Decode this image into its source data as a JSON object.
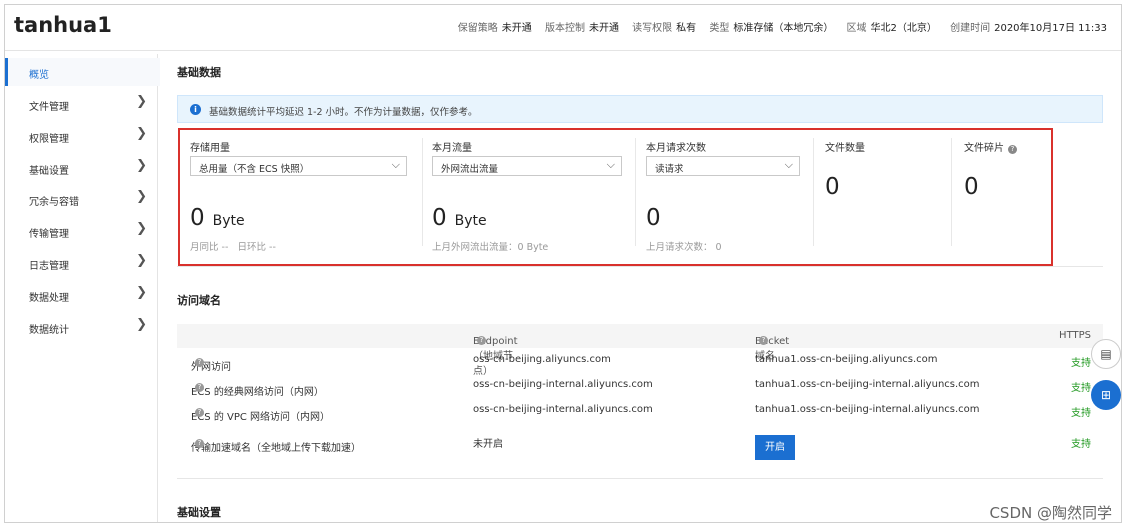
{
  "bucket_name": "tanhua1",
  "meta": [
    {
      "key": "保留策略",
      "value": "未开通"
    },
    {
      "key": "版本控制",
      "value": "未开通"
    },
    {
      "key": "读写权限",
      "value": "私有"
    },
    {
      "key": "类型",
      "value": "标准存储（本地冗余）"
    },
    {
      "key": "区域",
      "value": "华北2（北京）"
    },
    {
      "key": "创建时间",
      "value": "2020年10月17日 11:33"
    }
  ],
  "sidebar": [
    {
      "label": "概览"
    },
    {
      "label": "文件管理"
    },
    {
      "label": "权限管理"
    },
    {
      "label": "基础设置"
    },
    {
      "label": "冗余与容错"
    },
    {
      "label": "传输管理"
    },
    {
      "label": "日志管理"
    },
    {
      "label": "数据处理"
    },
    {
      "label": "数据统计"
    }
  ],
  "basic_data": {
    "title": "基础数据",
    "notice": "基础数据统计平均延迟 1-2 小时。不作为计量数据，仅作参考。",
    "storage": {
      "title": "存储用量",
      "select": "总用量（不含 ECS 快照）",
      "value": "0",
      "unit": "Byte",
      "sub_month": "月同比",
      "sub_month_val": "--",
      "sub_day": "日环比",
      "sub_day_val": "--"
    },
    "traffic": {
      "title": "本月流量",
      "select": "外网流出流量",
      "value": "0",
      "unit": "Byte",
      "sub": "上月外网流出流量：0 Byte"
    },
    "requests": {
      "title": "本月请求次数",
      "select": "读请求",
      "value": "0",
      "sub": "上月请求次数： 0"
    },
    "files": {
      "title": "文件数量",
      "value": "0"
    },
    "fragments": {
      "title": "文件碎片",
      "value": "0"
    }
  },
  "access_domain": {
    "title": "访问域名",
    "headers": {
      "endpoint": "Endpoint（地域节点）",
      "bucket": "Bucket 域名",
      "https": "HTTPS"
    },
    "rows": [
      {
        "name": "外网访问",
        "endpoint": "oss-cn-beijing.aliyuncs.com",
        "bucket": "tanhua1.oss-cn-beijing.aliyuncs.com",
        "https": "支持"
      },
      {
        "name": "ECS 的经典网络访问（内网）",
        "endpoint": "oss-cn-beijing-internal.aliyuncs.com",
        "bucket": "tanhua1.oss-cn-beijing-internal.aliyuncs.com",
        "https": "支持"
      },
      {
        "name": "ECS 的 VPC 网络访问（内网）",
        "endpoint": "oss-cn-beijing-internal.aliyuncs.com",
        "bucket": "tanhua1.oss-cn-beijing-internal.aliyuncs.com",
        "https": "支持"
      },
      {
        "name": "传输加速域名（全地域上传下载加速）",
        "endpoint": "未开启",
        "button": "开启",
        "https": "支持"
      }
    ]
  },
  "basic_settings_title": "基础设置",
  "watermark": "CSDN @陶然同学",
  "colors": {
    "accent": "#1b6fd1",
    "highlight_border": "#d9312c",
    "support": "#229922"
  }
}
